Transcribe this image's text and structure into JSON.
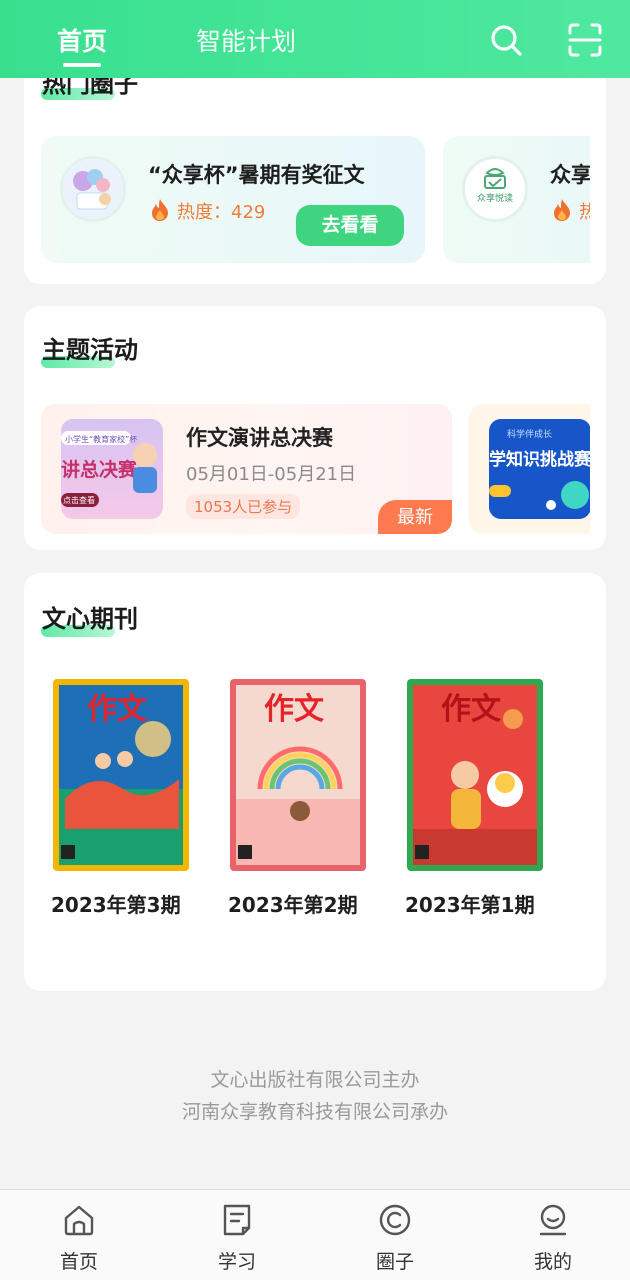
{
  "header": {
    "tabs": [
      {
        "label": "首页",
        "active": true
      },
      {
        "label": "智能计划",
        "active": false
      }
    ],
    "icons": [
      "search-icon",
      "scan-icon"
    ]
  },
  "hot_circles": {
    "title": "热门圈子",
    "items": [
      {
        "name": "“众享杯”暑期有奖征文",
        "heat_label": "热度：",
        "heat_value": "429",
        "button": "去看看"
      },
      {
        "name": "众享",
        "heat_label": "热",
        "avatar_text": "众享悦读"
      }
    ]
  },
  "activities": {
    "title": "主题活动",
    "items": [
      {
        "title": "作文演讲总决赛",
        "date": "05月01日-05月21日",
        "participants": "1053人已参与",
        "badge": "最新",
        "thumb_text": "讲总决赛",
        "thumb_top": "小学生“教育家校”杯",
        "thumb_btn": "点击查看"
      },
      {
        "thumb_text": "学知识挑战赛",
        "thumb_top": "科学伴成长"
      }
    ]
  },
  "journals": {
    "title": "文心期刊",
    "items": [
      {
        "label": "2023年第3期",
        "cover_title": "作文",
        "cover_color": "#f2b705"
      },
      {
        "label": "2023年第2期",
        "cover_title": "作文",
        "cover_color": "#e8646a"
      },
      {
        "label": "2023年第1期",
        "cover_title": "作文",
        "cover_color": "#2fa84f"
      }
    ]
  },
  "footer": {
    "line1": "文心出版社有限公司主办",
    "line2": "河南众享教育科技有限公司承办"
  },
  "bottom_nav": [
    {
      "label": "首页",
      "icon": "home-icon"
    },
    {
      "label": "学习",
      "icon": "study-icon"
    },
    {
      "label": "圈子",
      "icon": "circle-icon"
    },
    {
      "label": "我的",
      "icon": "profile-icon"
    }
  ],
  "colors": {
    "brand": "#3fe08f",
    "accent_orange": "#ef7d3c",
    "badge": "#ff7a4f"
  }
}
